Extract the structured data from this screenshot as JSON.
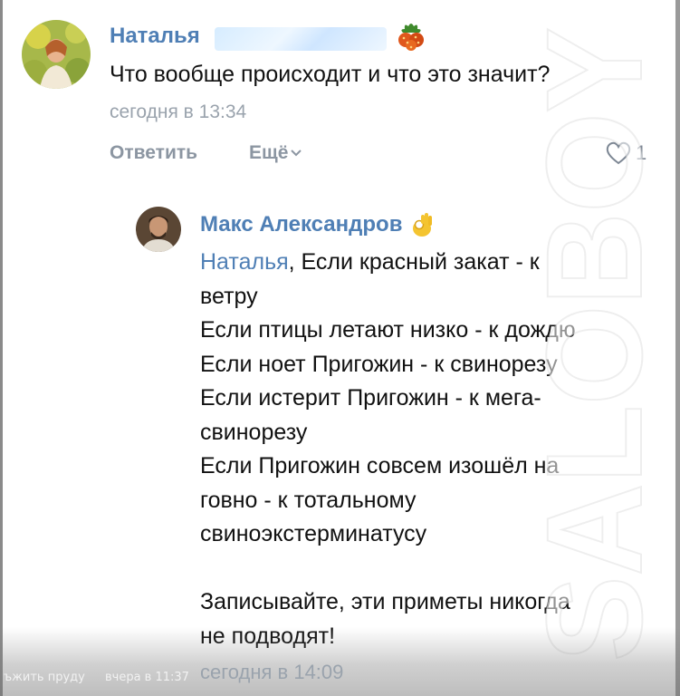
{
  "comment": {
    "author": "Наталья",
    "text": "Что вообще происходит и что это значит?",
    "time": "сегодня в 13:34",
    "actions": {
      "reply": "Ответить",
      "more": "Ещё",
      "likes": "1"
    }
  },
  "reply": {
    "author": "Макс Александров",
    "mention": "Наталья",
    "lines": [
      ", Если красный закат - к",
      "ветру",
      "Если птицы летают низко - к дождю",
      "Если ноет Пригожин - к свинорезу",
      "Если истерит Пригожин - к мега-",
      "свинорезу",
      "Если Пригожин совсем изошёл на",
      "говно - к тотальному",
      "свиноэкстерминатусу",
      "",
      "Записывайте, эти приметы никогда",
      "не подводят!"
    ],
    "time": "сегодня в 14:09"
  },
  "overlay": {
    "left_text": "ъжить пруду",
    "right_text": "вчера в 11:37"
  },
  "watermark": "SALOBOY",
  "colors": {
    "link": "#4f7fb5",
    "meta": "#9aa3ad",
    "text": "#111111"
  },
  "icons": {
    "name_emoji": "berry-icon",
    "reply_emoji": "ok-hand-icon",
    "like": "heart-icon",
    "more": "chevron-down-icon"
  }
}
